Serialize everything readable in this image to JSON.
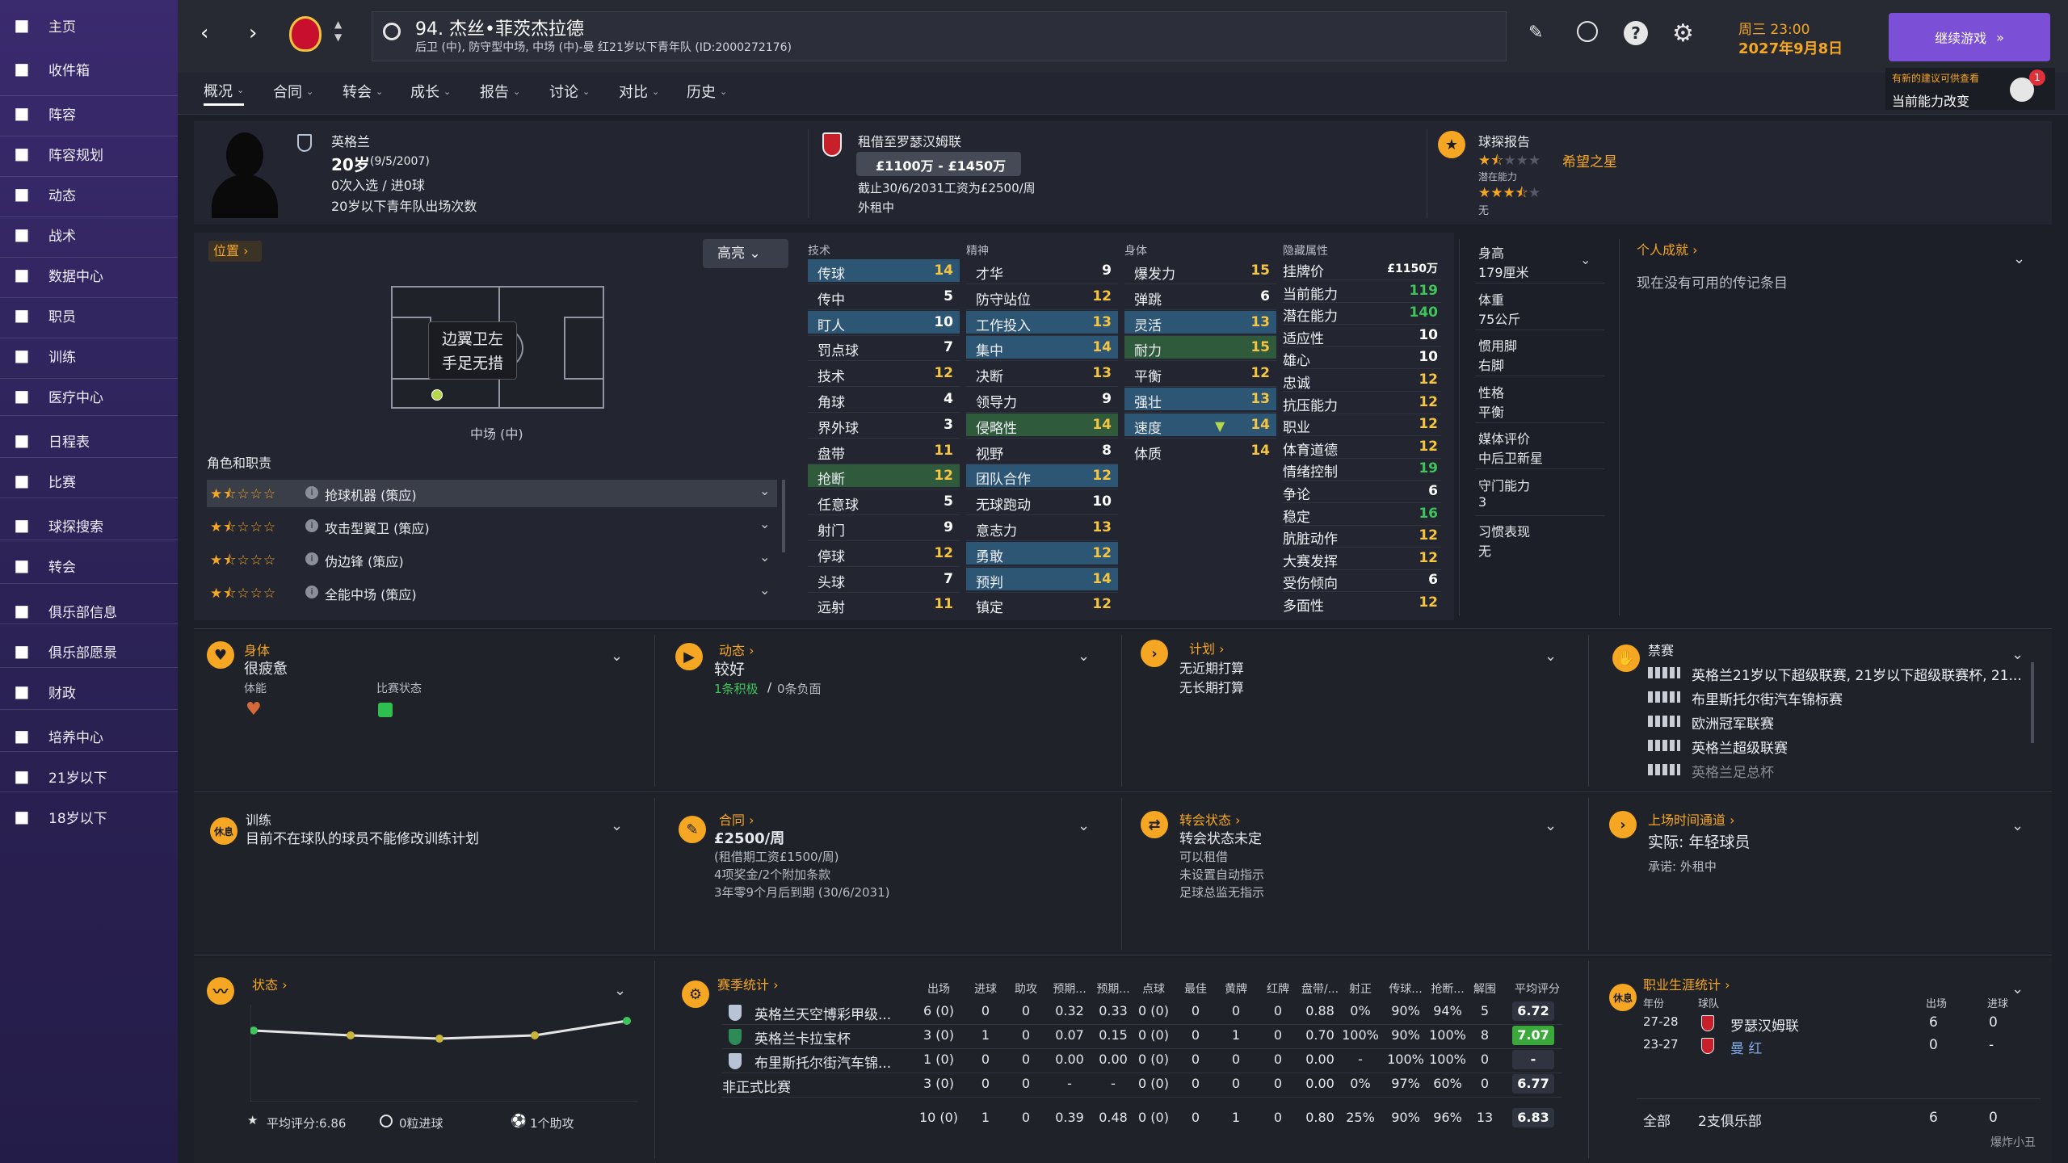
{
  "sidebar": {
    "items": [
      {
        "label": "主页",
        "icon": "home-icon"
      },
      {
        "label": "收件箱",
        "icon": "inbox-icon"
      },
      {
        "label": "阵容",
        "icon": "shirt-icon"
      },
      {
        "label": "阵容规划",
        "icon": "clipboard-icon"
      },
      {
        "label": "动态",
        "icon": "dynamics-icon"
      },
      {
        "label": "战术",
        "icon": "tactics-icon"
      },
      {
        "label": "数据中心",
        "icon": "data-icon"
      },
      {
        "label": "职员",
        "icon": "staff-icon"
      },
      {
        "label": "训练",
        "icon": "training-icon"
      },
      {
        "label": "医疗中心",
        "icon": "medical-icon"
      },
      {
        "label": "日程表",
        "icon": "calendar-icon"
      },
      {
        "label": "比赛",
        "icon": "trophy-icon"
      },
      {
        "label": "球探搜索",
        "icon": "search-icon"
      },
      {
        "label": "转会",
        "icon": "transfer-icon"
      },
      {
        "label": "俱乐部信息",
        "icon": "shield-icon"
      },
      {
        "label": "俱乐部愿景",
        "icon": "vision-icon"
      },
      {
        "label": "财政",
        "icon": "finance-icon"
      },
      {
        "label": "培养中心",
        "icon": "development-icon"
      },
      {
        "label": "21岁以下",
        "icon": "u21-icon"
      },
      {
        "label": "18岁以下",
        "icon": "u18-icon"
      }
    ]
  },
  "header": {
    "title": "94. 杰丝•菲茨杰拉德",
    "subtitle": "后卫 (中), 防守型中场, 中场 (中)-曼 红21岁以下青年队 (ID:2000272176)",
    "day_time": "周三 23:00",
    "date": "2027年9月8日",
    "continue_label": "继续游戏",
    "suggestion_label": "有新的建议可供查看",
    "suggestion_sub": "当前能力改变",
    "badge_count": "1"
  },
  "tabs": [
    {
      "label": "概况"
    },
    {
      "label": "合同"
    },
    {
      "label": "转会"
    },
    {
      "label": "成长"
    },
    {
      "label": "报告"
    },
    {
      "label": "讨论"
    },
    {
      "label": "对比"
    },
    {
      "label": "历史"
    }
  ],
  "profile": {
    "nationality": "英格兰",
    "age": "20岁",
    "dob": "(9/5/2007)",
    "caps": "0次入选 / 进0球",
    "youth_caps": "20岁以下青年队出场次数",
    "loan_label": "租借至罗瑟汉姆联",
    "value_range": "£1100万 - £1450万",
    "contract": "截止30/6/2031工资为£2500/周",
    "loan_status": "外租中",
    "scout_label": "球探报告",
    "scout_tag": "希望之星",
    "potential_label": "潜在能力",
    "potential_none": "无",
    "current_stars": 1.5,
    "potential_stars": 3.5
  },
  "position": {
    "header": "位置",
    "highlight_btn": "高亮",
    "tooltip_line1": "边翼卫左",
    "tooltip_line2": "手足无措",
    "label": "中场 (中)",
    "roles_header": "角色和职责",
    "roles": [
      {
        "name": "抢球机器 (策应)",
        "stars": 1.5
      },
      {
        "name": "攻击型翼卫 (策应)",
        "stars": 1.5
      },
      {
        "name": "伪边锋 (策应)",
        "stars": 1.5
      },
      {
        "name": "全能中场 (策应)",
        "stars": 1.5
      }
    ]
  },
  "attributes": {
    "tech_header": "技术",
    "mental_header": "精神",
    "phys_header": "身体",
    "hidden_header": "隐藏属性",
    "technical": [
      {
        "name": "传球",
        "v": "14"
      },
      {
        "name": "传中",
        "v": "5"
      },
      {
        "name": "盯人",
        "v": "10"
      },
      {
        "name": "罚点球",
        "v": "7"
      },
      {
        "name": "技术",
        "v": "12"
      },
      {
        "name": "角球",
        "v": "4"
      },
      {
        "name": "界外球",
        "v": "3"
      },
      {
        "name": "盘带",
        "v": "11"
      },
      {
        "name": "抢断",
        "v": "12"
      },
      {
        "name": "任意球",
        "v": "5"
      },
      {
        "name": "射门",
        "v": "9"
      },
      {
        "name": "停球",
        "v": "12"
      },
      {
        "name": "头球",
        "v": "7"
      },
      {
        "name": "远射",
        "v": "11"
      }
    ],
    "mental": [
      {
        "name": "才华",
        "v": "9"
      },
      {
        "name": "防守站位",
        "v": "12"
      },
      {
        "name": "工作投入",
        "v": "13"
      },
      {
        "name": "集中",
        "v": "14"
      },
      {
        "name": "决断",
        "v": "13"
      },
      {
        "name": "领导力",
        "v": "9"
      },
      {
        "name": "侵略性",
        "v": "14"
      },
      {
        "name": "视野",
        "v": "8"
      },
      {
        "name": "团队合作",
        "v": "12"
      },
      {
        "name": "无球跑动",
        "v": "10"
      },
      {
        "name": "意志力",
        "v": "13"
      },
      {
        "name": "勇敢",
        "v": "12"
      },
      {
        "name": "预判",
        "v": "14"
      },
      {
        "name": "镇定",
        "v": "12"
      }
    ],
    "physical": [
      {
        "name": "爆发力",
        "v": "15"
      },
      {
        "name": "弹跳",
        "v": "6"
      },
      {
        "name": "灵活",
        "v": "13"
      },
      {
        "name": "耐力",
        "v": "15"
      },
      {
        "name": "平衡",
        "v": "12"
      },
      {
        "name": "强壮",
        "v": "13"
      },
      {
        "name": "速度",
        "v": "14"
      },
      {
        "name": "体质",
        "v": "14"
      }
    ],
    "hidden": [
      {
        "name": "挂牌价",
        "v": "£1150万"
      },
      {
        "name": "当前能力",
        "v": "119"
      },
      {
        "name": "潜在能力",
        "v": "140"
      },
      {
        "name": "适应性",
        "v": "10"
      },
      {
        "name": "雄心",
        "v": "10"
      },
      {
        "name": "忠诚",
        "v": "12"
      },
      {
        "name": "抗压能力",
        "v": "12"
      },
      {
        "name": "职业",
        "v": "12"
      },
      {
        "name": "体育道德",
        "v": "12"
      },
      {
        "name": "情绪控制",
        "v": "19"
      },
      {
        "name": "争论",
        "v": "6"
      },
      {
        "name": "稳定",
        "v": "16"
      },
      {
        "name": "肮脏动作",
        "v": "12"
      },
      {
        "name": "大赛发挥",
        "v": "12"
      },
      {
        "name": "受伤倾向",
        "v": "6"
      },
      {
        "name": "多面性",
        "v": "12"
      }
    ]
  },
  "info": {
    "height_label": "身高",
    "height": "179厘米",
    "weight_label": "体重",
    "weight": "75公斤",
    "foot_label": "惯用脚",
    "foot": "右脚",
    "personality_label": "性格",
    "personality": "平衡",
    "media_label": "媒体评价",
    "media": "中后卫新星",
    "gk_label": "守门能力",
    "gk": "3",
    "habits_label": "习惯表现",
    "habits": "无",
    "achievements_label": "个人成就",
    "achievements_empty": "现在没有可用的传记条目"
  },
  "cards": {
    "body": {
      "title": "身体",
      "value": "很疲惫",
      "fitness_label": "体能",
      "match_label": "比赛状态"
    },
    "dynamics": {
      "title": "动态",
      "value": "较好",
      "pos": "1条积极",
      "neg": "0条负面",
      "sep": "/"
    },
    "plans": {
      "title": "计划",
      "line1": "无近期打算",
      "line2": "无长期打算"
    },
    "bans": {
      "title": "禁赛",
      "items": [
        "英格兰21岁以下超级联赛, 21岁以下超级联赛杯, 21...",
        "布里斯托尔街汽车锦标赛",
        "欧洲冠军联赛",
        "英格兰超级联赛",
        "英格兰足总杯"
      ]
    },
    "training": {
      "title": "训练",
      "value": "目前不在球队的球员不能修改训练计划",
      "badge": "休息"
    },
    "contract": {
      "title": "合同",
      "value": "£2500/周",
      "l1": "(租借期工资£1500/周)",
      "l2": "4项奖金/2个附加条款",
      "l3": "3年零9个月后到期 (30/6/2031)"
    },
    "transfer": {
      "title": "转会状态",
      "value": "转会状态未定",
      "l1": "可以租借",
      "l2": "未设置自动指示",
      "l3": "足球总监无指示"
    },
    "playtime": {
      "title": "上场时间通道",
      "value": "实际: 年轻球员",
      "l1": "承诺: 外租中"
    },
    "form": {
      "title": "状态",
      "avg": "平均评分:6.86",
      "goals": "0粒进球",
      "assists": "1个助攻",
      "ratings": [
        6.8,
        6.85,
        6.9,
        6.86,
        6.72
      ]
    },
    "season": {
      "title": "赛季统计",
      "headers": [
        "出场",
        "进球",
        "助攻",
        "预期...",
        "预期...",
        "点球",
        "最佳",
        "黄牌",
        "红牌",
        "盘带/...",
        "射正",
        "传球...",
        "抢断...",
        "解围",
        "平均评分"
      ],
      "rows": [
        {
          "comp": "英格兰天空博彩甲级...",
          "cells": [
            "6 (0)",
            "0",
            "0",
            "0.32",
            "0.33",
            "0 (0)",
            "0",
            "0",
            "0",
            "0.88",
            "0%",
            "90%",
            "94%",
            "5"
          ],
          "rating": "6.72",
          "rc": "#2f3440"
        },
        {
          "comp": "英格兰卡拉宝杯",
          "cells": [
            "3 (0)",
            "1",
            "0",
            "0.07",
            "0.15",
            "0 (0)",
            "0",
            "1",
            "0",
            "0.70",
            "100%",
            "90%",
            "100%",
            "8"
          ],
          "rating": "7.07",
          "rc": "#3aa83a"
        },
        {
          "comp": "布里斯托尔街汽车锦...",
          "cells": [
            "1 (0)",
            "0",
            "0",
            "0.00",
            "0.00",
            "0 (0)",
            "0",
            "0",
            "0",
            "0.00",
            "-",
            "100%",
            "100%",
            "0"
          ],
          "rating": "-",
          "rc": "#2f3440"
        },
        {
          "comp": "非正式比赛",
          "cells": [
            "3 (0)",
            "0",
            "0",
            "-",
            "-",
            "0 (0)",
            "0",
            "0",
            "0",
            "0.00",
            "0%",
            "97%",
            "60%",
            "0"
          ],
          "rating": "6.77",
          "rc": "#2f3440"
        },
        {
          "comp": "",
          "cells": [
            "10 (0)",
            "1",
            "0",
            "0.39",
            "0.48",
            "0 (0)",
            "0",
            "1",
            "0",
            "0.80",
            "25%",
            "90%",
            "96%",
            "13"
          ],
          "rating": "6.83",
          "rc": "#2f3440"
        }
      ]
    },
    "career": {
      "title": "职业生涯统计",
      "col_year": "年份",
      "col_team": "球队",
      "col_apps": "出场",
      "col_goals": "进球",
      "badge": "休息",
      "rows": [
        {
          "year": "27-28",
          "team": "罗瑟汉姆联",
          "apps": "6",
          "goals": "0"
        },
        {
          "year": "23-27",
          "team": "曼 红",
          "apps": "0",
          "goals": "-"
        }
      ],
      "total_label": "全部",
      "total_clubs": "2支俱乐部",
      "total_apps": "6",
      "total_goals": "0"
    }
  },
  "watermark": "爆炸小丑"
}
